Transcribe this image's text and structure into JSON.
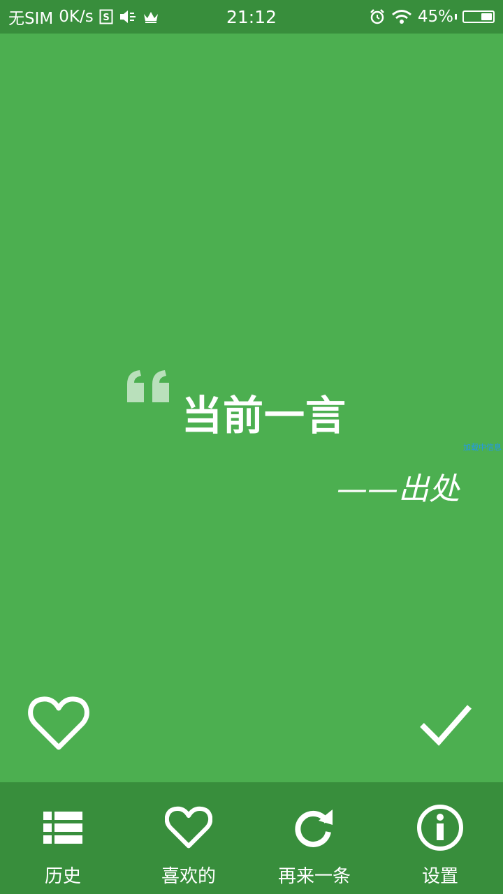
{
  "status_bar": {
    "carrier": "无SIM",
    "speed": "0K/s",
    "time": "21:12",
    "battery_percent": "45%",
    "battery_level": 0.45,
    "icons_left": [
      "sim-s-icon",
      "vibrate-icon",
      "crown-icon"
    ],
    "icons_right": [
      "alarm-icon",
      "wifi-icon",
      "battery-icon"
    ]
  },
  "quote": {
    "text": "当前一言",
    "source": "——出处",
    "side_label": "加载中信息"
  },
  "actions": {
    "like_icon": "heart-outline-icon",
    "check_icon": "check-icon"
  },
  "bottom_nav": {
    "items": [
      {
        "label": "历史",
        "icon": "list-icon"
      },
      {
        "label": "喜欢的",
        "icon": "heart-outline-icon"
      },
      {
        "label": "再来一条",
        "icon": "refresh-icon"
      },
      {
        "label": "设置",
        "icon": "info-icon"
      }
    ]
  },
  "colors": {
    "background": "#4caf50",
    "bars": "#388e3c",
    "foreground": "#ffffff"
  }
}
